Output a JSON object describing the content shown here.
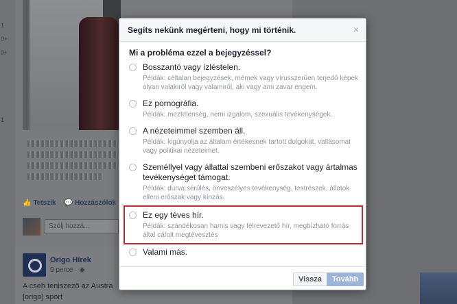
{
  "modal": {
    "title": "Segíts nekünk megérteni, hogy mi történik.",
    "close_label": "×",
    "question": "Mi a probléma ezzel a bejegyzéssel?",
    "options": [
      {
        "label": "Bosszantó vagy ízléstelen.",
        "desc": "Példák: céltalan bejegyzések, mémek vagy vírusszerűen terjedő képek olyan valakiről vagy valamiről, aki vagy ami zavar engem."
      },
      {
        "label": "Ez pornográfia.",
        "desc": "Példák: meztelenség, nemi izgalom, szexuális tevékenységek."
      },
      {
        "label": "A nézeteimmel szemben áll.",
        "desc": "Példák: kigúnyolja az általam értékesnek tartott dolgokat, vallásomat vagy politikai nézeteimet."
      },
      {
        "label": "Személlyel vagy állattal szembeni erőszakot vagy ártalmas tevékenységet támogat.",
        "desc": "Példák: durva sérülés, önveszélyes tevékenység, testrészek, állatok elleni erőszak vagy kínzás."
      },
      {
        "label": "Ez egy téves hír.",
        "desc": "Példák: szándékosan hamis vagy félrevezető hír, megbízható forrás által cáfolt megtévesztés"
      },
      {
        "label": "Valami más.",
        "desc": ""
      }
    ],
    "back_label": "Vissza",
    "next_label": "Tovább"
  },
  "background": {
    "edge_numbers": [
      "1",
      "0+",
      "0+",
      "1"
    ],
    "like_label": "Tetszik",
    "comment_label": "Hozzászólok",
    "comment_placeholder": "Szólj hozzá...",
    "post_author": "Origo Hírek",
    "post_time": "9 perce · ",
    "post_text": "A cseh teniszező az Austra",
    "post_source": "[origo] sport"
  },
  "colors": {
    "highlight_border": "#b52b36",
    "primary_button_disabled": "#9cb4d8"
  }
}
